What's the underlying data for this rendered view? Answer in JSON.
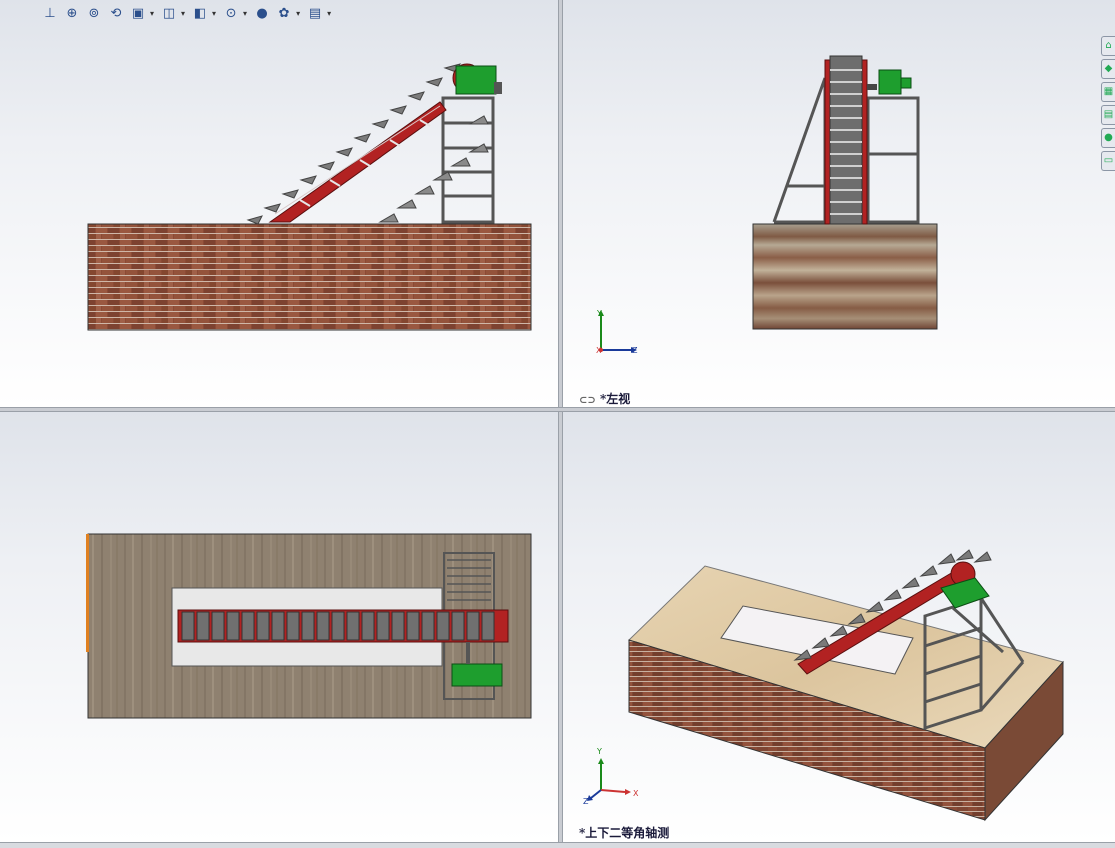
{
  "toolbar": {
    "tools": [
      {
        "name": "standard-views-icon",
        "glyph": "⊥"
      },
      {
        "name": "zoom-to-fit-icon",
        "glyph": "⊕"
      },
      {
        "name": "zoom-to-area-icon",
        "glyph": "⊚"
      },
      {
        "name": "previous-view-icon",
        "glyph": "⟲"
      },
      {
        "name": "section-view-icon",
        "glyph": "▣"
      },
      {
        "name": "view-orientation-icon",
        "glyph": "◫"
      },
      {
        "name": "display-style-icon",
        "glyph": "◧"
      },
      {
        "name": "hide-show-items-icon",
        "glyph": "⊙"
      },
      {
        "name": "edit-appearance-icon",
        "glyph": "●"
      },
      {
        "name": "apply-scene-icon",
        "glyph": "✿"
      },
      {
        "name": "view-settings-icon",
        "glyph": "▤"
      }
    ]
  },
  "views": {
    "top_right_label": "*左视",
    "bottom_right_label": "*上下二等角轴测"
  },
  "triad": {
    "y": "Y",
    "x": "X",
    "z": "Z"
  },
  "task_pane": {
    "tabs": [
      "home-tab",
      "resources-tab",
      "design-library-tab",
      "file-explorer-tab",
      "appearances-tab",
      "custom-properties-tab"
    ]
  }
}
